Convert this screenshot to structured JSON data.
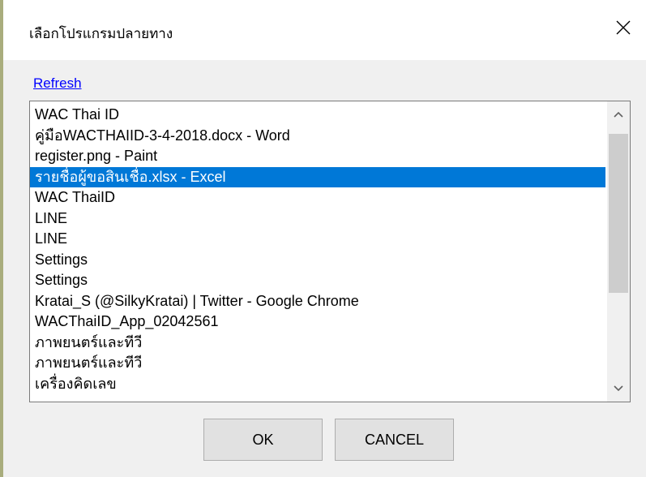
{
  "dialog": {
    "title": "เลือกโปรแกรมปลายทาง",
    "close_icon": "close-icon"
  },
  "refresh_label": "Refresh",
  "windows": [
    {
      "label": "WAC Thai ID",
      "selected": false
    },
    {
      "label": "คู่มือWACTHAIID-3-4-2018.docx - Word",
      "selected": false
    },
    {
      "label": "register.png - Paint",
      "selected": false
    },
    {
      "label": "รายชื่อผู้ขอสินเชื่อ.xlsx - Excel",
      "selected": true
    },
    {
      "label": "WAC ThaiID",
      "selected": false
    },
    {
      "label": "LINE",
      "selected": false
    },
    {
      "label": "LINE",
      "selected": false
    },
    {
      "label": "Settings",
      "selected": false
    },
    {
      "label": "Settings",
      "selected": false
    },
    {
      "label": "Kratai_S (@SilkyKratai) | Twitter - Google Chrome",
      "selected": false
    },
    {
      "label": "WACThaiID_App_02042561",
      "selected": false
    },
    {
      "label": "ภาพยนตร์และทีวี",
      "selected": false
    },
    {
      "label": "ภาพยนตร์และทีวี",
      "selected": false
    },
    {
      "label": "เครื่องคิดเลข",
      "selected": false
    }
  ],
  "buttons": {
    "ok_label": "OK",
    "cancel_label": "CANCEL"
  },
  "colors": {
    "selection": "#0078d7",
    "link": "#0000ff"
  }
}
